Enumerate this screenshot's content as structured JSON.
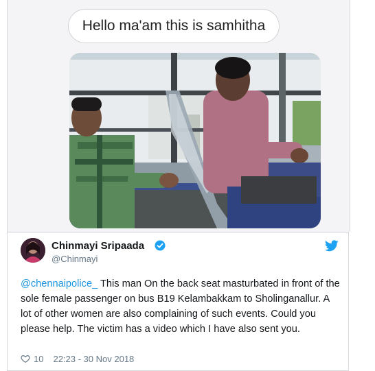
{
  "message": {
    "bubble_text": "Hello ma'am this is samhitha"
  },
  "tweet": {
    "author_name": "Chinmayi Sripaada",
    "author_handle": "@Chinmayi",
    "mention": "@chennaipolice_",
    "text": " This man On the back seat masturbated in front of the sole female passenger on bus B19 Kelambakkam to Sholinganallur. A lot of other women are also complaining of such events. Could you please help. The victim has a video which I have also sent you.",
    "likes": "10",
    "timestamp": "22:23 - 30 Nov 2018"
  },
  "colors": {
    "mention": "#1b95e0",
    "verified": "#1da1f2",
    "twitter_bird": "#1da1f2"
  },
  "icons": {
    "verified": "verified-badge-icon",
    "brand": "twitter-bird-icon",
    "like": "heart-icon"
  }
}
